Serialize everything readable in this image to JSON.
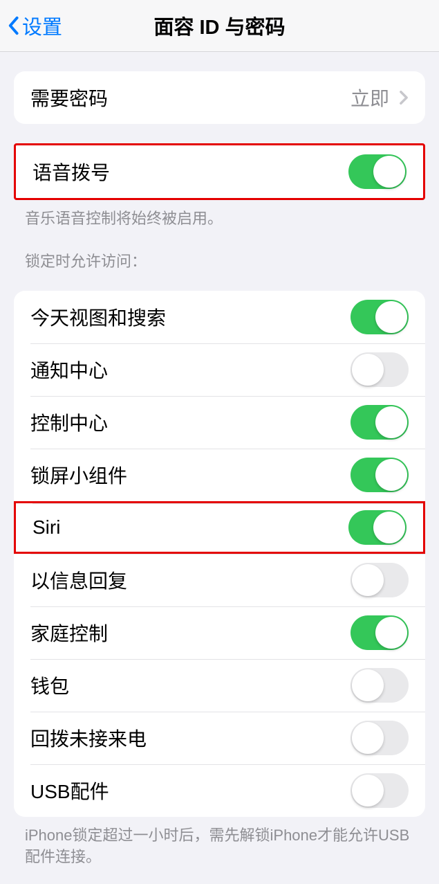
{
  "nav": {
    "back_label": "设置",
    "title": "面容 ID 与密码"
  },
  "require_passcode": {
    "label": "需要密码",
    "value": "立即"
  },
  "voice_dial": {
    "label": "语音拨号",
    "footer": "音乐语音控制将始终被启用。"
  },
  "section_header": "锁定时允许访问：",
  "access_items": [
    {
      "label": "今天视图和搜索",
      "on": true
    },
    {
      "label": "通知中心",
      "on": false
    },
    {
      "label": "控制中心",
      "on": true
    },
    {
      "label": "锁屏小组件",
      "on": true
    },
    {
      "label": "Siri",
      "on": true
    },
    {
      "label": "以信息回复",
      "on": false
    },
    {
      "label": "家庭控制",
      "on": true
    },
    {
      "label": "钱包",
      "on": false
    },
    {
      "label": "回拨未接来电",
      "on": false
    },
    {
      "label": "USB配件",
      "on": false
    }
  ],
  "usb_footer": "iPhone锁定超过一小时后，需先解锁iPhone才能允许USB配件连接。",
  "highlights": {
    "voice_dial_group": true,
    "siri_row": true
  }
}
